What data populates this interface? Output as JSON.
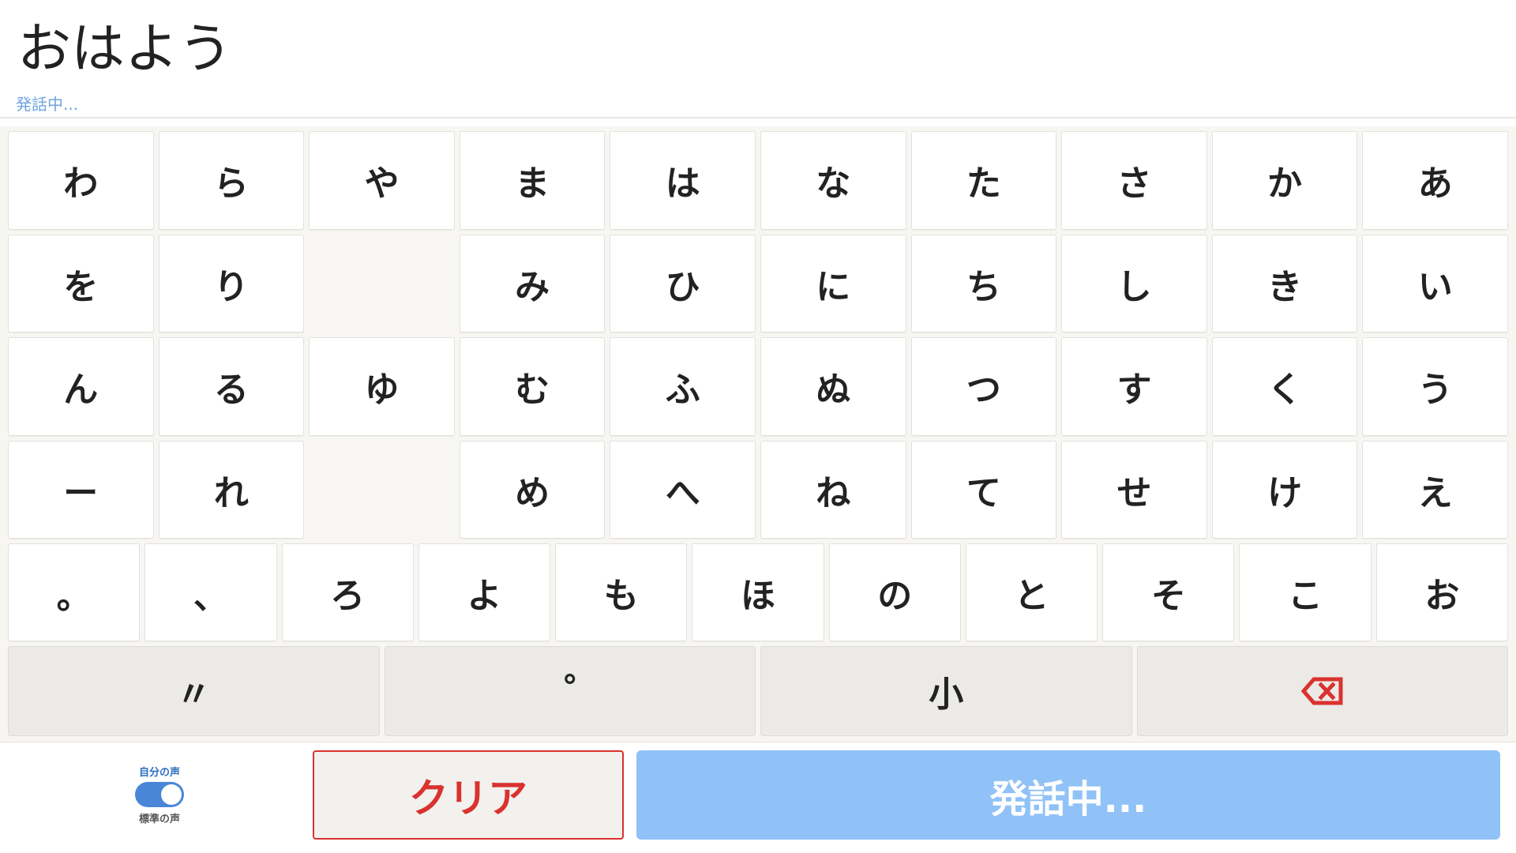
{
  "display": {
    "text": "おはよう",
    "status": "発話中..."
  },
  "kana_rows": [
    [
      "わ",
      "ら",
      "や",
      "ま",
      "は",
      "な",
      "た",
      "さ",
      "か",
      "あ"
    ],
    [
      "を",
      "り",
      "",
      "み",
      "ひ",
      "に",
      "ち",
      "し",
      "き",
      "い"
    ],
    [
      "ん",
      "る",
      "ゆ",
      "む",
      "ふ",
      "ぬ",
      "つ",
      "す",
      "く",
      "う"
    ],
    [
      "ー",
      "れ",
      "",
      "め",
      "へ",
      "ね",
      "て",
      "せ",
      "け",
      "え"
    ]
  ],
  "kana_row5": [
    "。",
    "、",
    "ろ",
    "よ",
    "も",
    "ほ",
    "の",
    "と",
    "そ",
    "こ",
    "お"
  ],
  "function_keys": {
    "dakuten": "〃",
    "handakuten": "°",
    "small": "小",
    "delete": "⌫"
  },
  "voice_toggle": {
    "label_on": "自分の声",
    "label_off": "標準の声",
    "state": "on"
  },
  "buttons": {
    "clear": "クリア",
    "speak": "発話中..."
  },
  "colors": {
    "accent_blue": "#90c2f7",
    "toggle_blue": "#4a86d8",
    "danger_red": "#d9322f",
    "status_blue": "#6fa4de"
  }
}
